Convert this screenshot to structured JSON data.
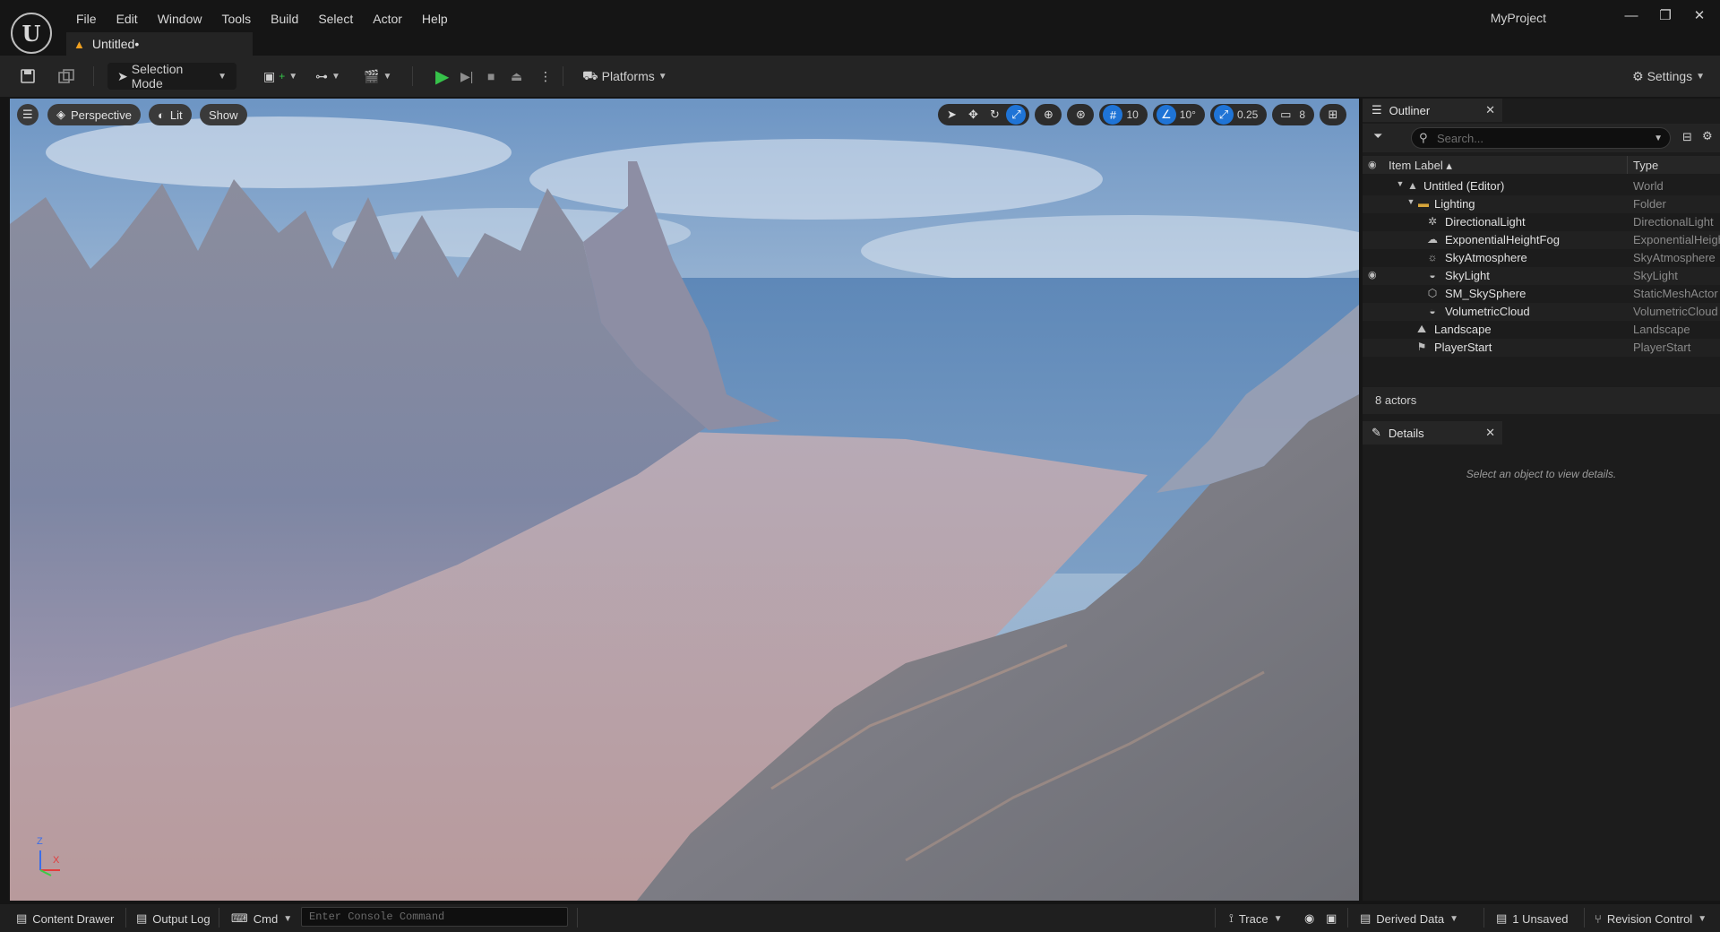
{
  "app": {
    "project_name": "MyProject",
    "level_tab": "Untitled•"
  },
  "menu": [
    "File",
    "Edit",
    "Window",
    "Tools",
    "Build",
    "Select",
    "Actor",
    "Help"
  ],
  "toolbar": {
    "selection_mode": "Selection Mode",
    "platforms": "Platforms",
    "settings": "Settings"
  },
  "viewport": {
    "perspective": "Perspective",
    "lit": "Lit",
    "show": "Show",
    "grid_snap": "10",
    "rotation_snap": "10°",
    "scale_snap": "0.25",
    "camera_speed": "8",
    "axis_z": "Z",
    "axis_x": "X"
  },
  "outliner": {
    "tab_title": "Outliner",
    "search_placeholder": "Search...",
    "col_label": "Item Label ▴",
    "col_type": "Type",
    "rows": [
      {
        "label": "Untitled (Editor)",
        "type": "World",
        "icon": "world-icon"
      },
      {
        "label": "Lighting",
        "type": "Folder",
        "icon": "folder-icon"
      },
      {
        "label": "DirectionalLight",
        "type": "DirectionalLight",
        "icon": "sun-icon"
      },
      {
        "label": "ExponentialHeightFog",
        "type": "ExponentialHeightFog",
        "icon": "fog-icon"
      },
      {
        "label": "SkyAtmosphere",
        "type": "SkyAtmosphere",
        "icon": "atmosphere-icon"
      },
      {
        "label": "SkyLight",
        "type": "SkyLight",
        "icon": "skylight-icon"
      },
      {
        "label": "SM_SkySphere",
        "type": "StaticMeshActor",
        "icon": "mesh-icon"
      },
      {
        "label": "VolumetricCloud",
        "type": "VolumetricCloud",
        "icon": "cloud-icon"
      },
      {
        "label": "Landscape",
        "type": "Landscape",
        "icon": "landscape-icon"
      },
      {
        "label": "PlayerStart",
        "type": "PlayerStart",
        "icon": "flag-icon"
      }
    ],
    "actor_count": "8 actors"
  },
  "details": {
    "tab_title": "Details",
    "hint": "Select an object to view details."
  },
  "statusbar": {
    "content_drawer": "Content Drawer",
    "output_log": "Output Log",
    "cmd": "Cmd",
    "console_placeholder": "Enter Console Command",
    "trace": "Trace",
    "derived_data": "Derived Data",
    "unsaved": "1 Unsaved",
    "revision_control": "Revision Control"
  },
  "colors": {
    "accent_blue": "#1f74d6",
    "play_green": "#36c24a",
    "warning_orange": "#f0a020"
  }
}
